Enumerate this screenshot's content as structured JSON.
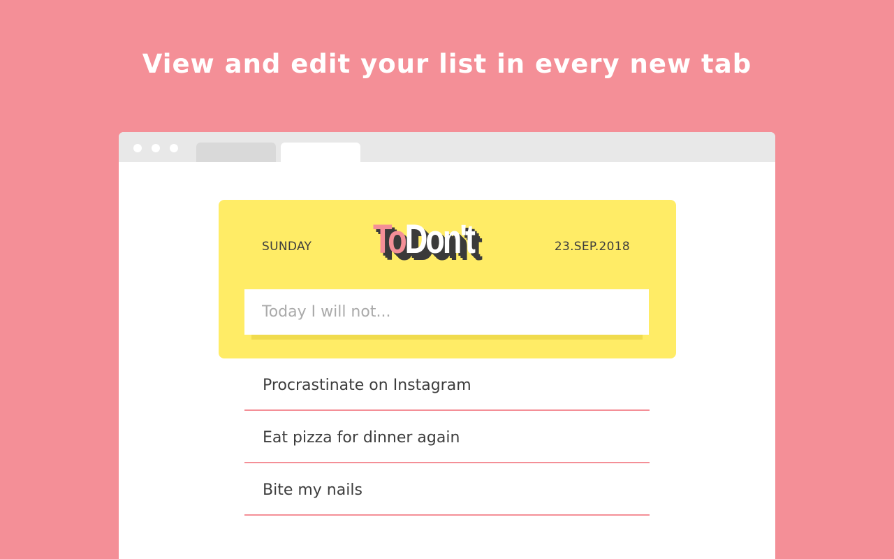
{
  "headline": "View and edit your list in every new tab",
  "app": {
    "day": "SUNDAY",
    "date": "23.SEP.2018",
    "logo": {
      "part1": "To",
      "part2": "Don't"
    },
    "input": {
      "placeholder": "Today I will not...",
      "value": ""
    },
    "items": [
      {
        "text": "Procrastinate on Instagram"
      },
      {
        "text": "Eat pizza for dinner again"
      },
      {
        "text": "Bite my nails"
      }
    ]
  },
  "colors": {
    "background": "#f48f97",
    "card": "#ffec66",
    "accent": "#f48f97",
    "text": "#3d3d3d"
  }
}
